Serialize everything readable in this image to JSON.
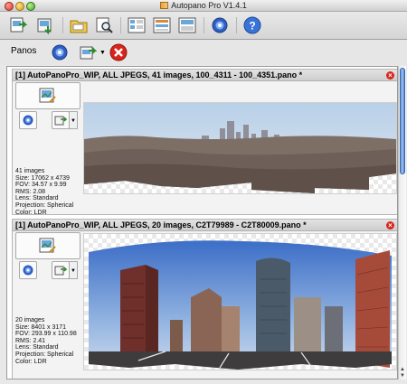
{
  "window": {
    "title": "Autopano Pro V1.4.1"
  },
  "toolbar": {
    "icons": [
      "new-project-icon",
      "save-project-icon",
      "open-folder-icon",
      "search-folder-icon",
      "panel-layout-1-icon",
      "panel-layout-2-icon",
      "panel-layout-3-icon",
      "settings-gear-icon",
      "help-icon"
    ]
  },
  "panos_header": {
    "label": "Panos"
  },
  "panos": [
    {
      "title": "[1] AutoPanoPro_WIP, ALL JPEGS, 41 images, 100_4311 - 100_4351.pano *",
      "info": [
        "41 images",
        "Size: 17062 x 4739",
        "FOV: 34.57 x 9.99",
        "RMS: 2.08",
        "Lens: Standard",
        "Projection: Spherical",
        "Color: LDR"
      ]
    },
    {
      "title": "[1] AutoPanoPro_WIP, ALL JPEGS, 20 images, C2T79989 - C2T80009.pano *",
      "info": [
        "20 images",
        "Size: 8401 x 3171",
        "FOV: 293.99 x 110.98",
        "RMS: 2.41",
        "Lens: Standard",
        "Projection: Spherical",
        "Color: LDR"
      ]
    }
  ],
  "colors": {
    "accent": "#4a7fcf",
    "close": "#d9241b"
  }
}
